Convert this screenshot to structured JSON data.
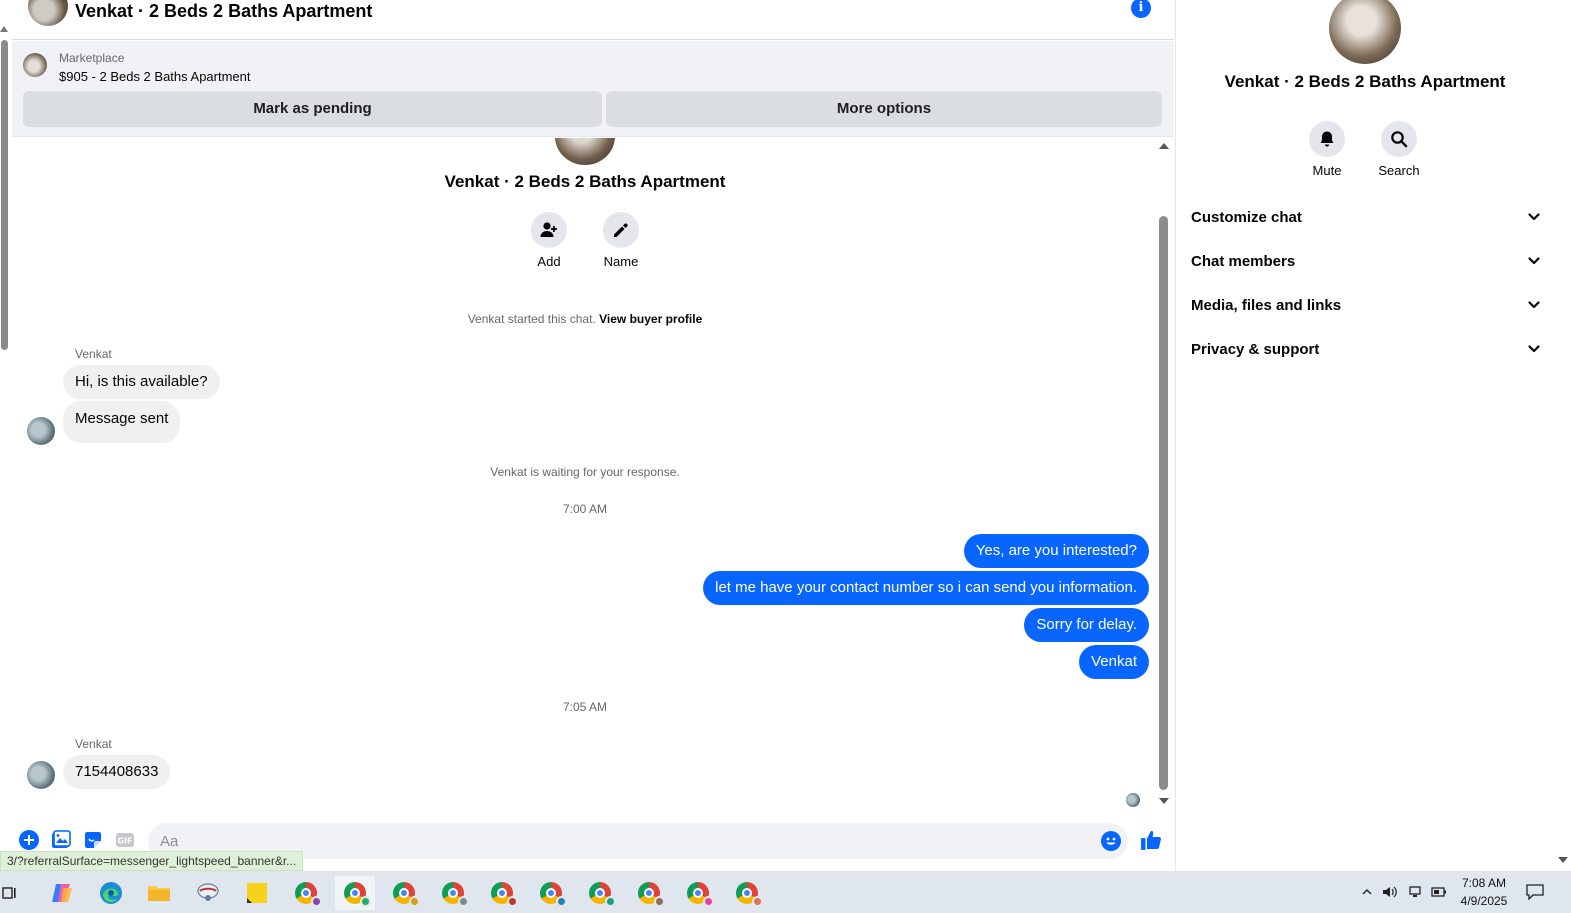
{
  "header": {
    "title": "Venkat · 2 Beds 2 Baths Apartment"
  },
  "marketplace": {
    "label": "Marketplace",
    "listing": "$905 - 2 Beds 2 Baths Apartment",
    "pending_label": "Mark as pending",
    "more_label": "More options"
  },
  "intro": {
    "title": "Venkat · 2 Beds 2 Baths Apartment",
    "add_label": "Add",
    "name_label": "Name",
    "started_text": "Venkat started this chat.",
    "view_profile": "View buyer profile"
  },
  "conversation": {
    "sender": "Venkat",
    "incoming_1": "Hi, is this available?",
    "incoming_2": "Message sent",
    "waiting_note": "Venkat is waiting for your response.",
    "time_1": "7:00 AM",
    "outgoing": [
      "Yes, are you interested?",
      "let me have your contact number so i can send you information.",
      "Sorry for delay.",
      "Venkat"
    ],
    "time_2": "7:05 AM",
    "incoming_3": "7154408633"
  },
  "composer": {
    "placeholder": "Aa"
  },
  "status_url": "3/?referralSurface=messenger_lightspeed_banner&r...",
  "right_panel": {
    "title": "Venkat · 2 Beds 2 Baths Apartment",
    "mute_label": "Mute",
    "search_label": "Search",
    "sections": [
      "Customize chat",
      "Chat members",
      "Media, files and links",
      "Privacy & support"
    ]
  },
  "taskbar": {
    "time": "7:08 AM",
    "date": "4/9/2025"
  },
  "colors": {
    "accent": "#0866ff",
    "bubble_in": "#f0f0f0",
    "button_bg": "#dadde1"
  }
}
